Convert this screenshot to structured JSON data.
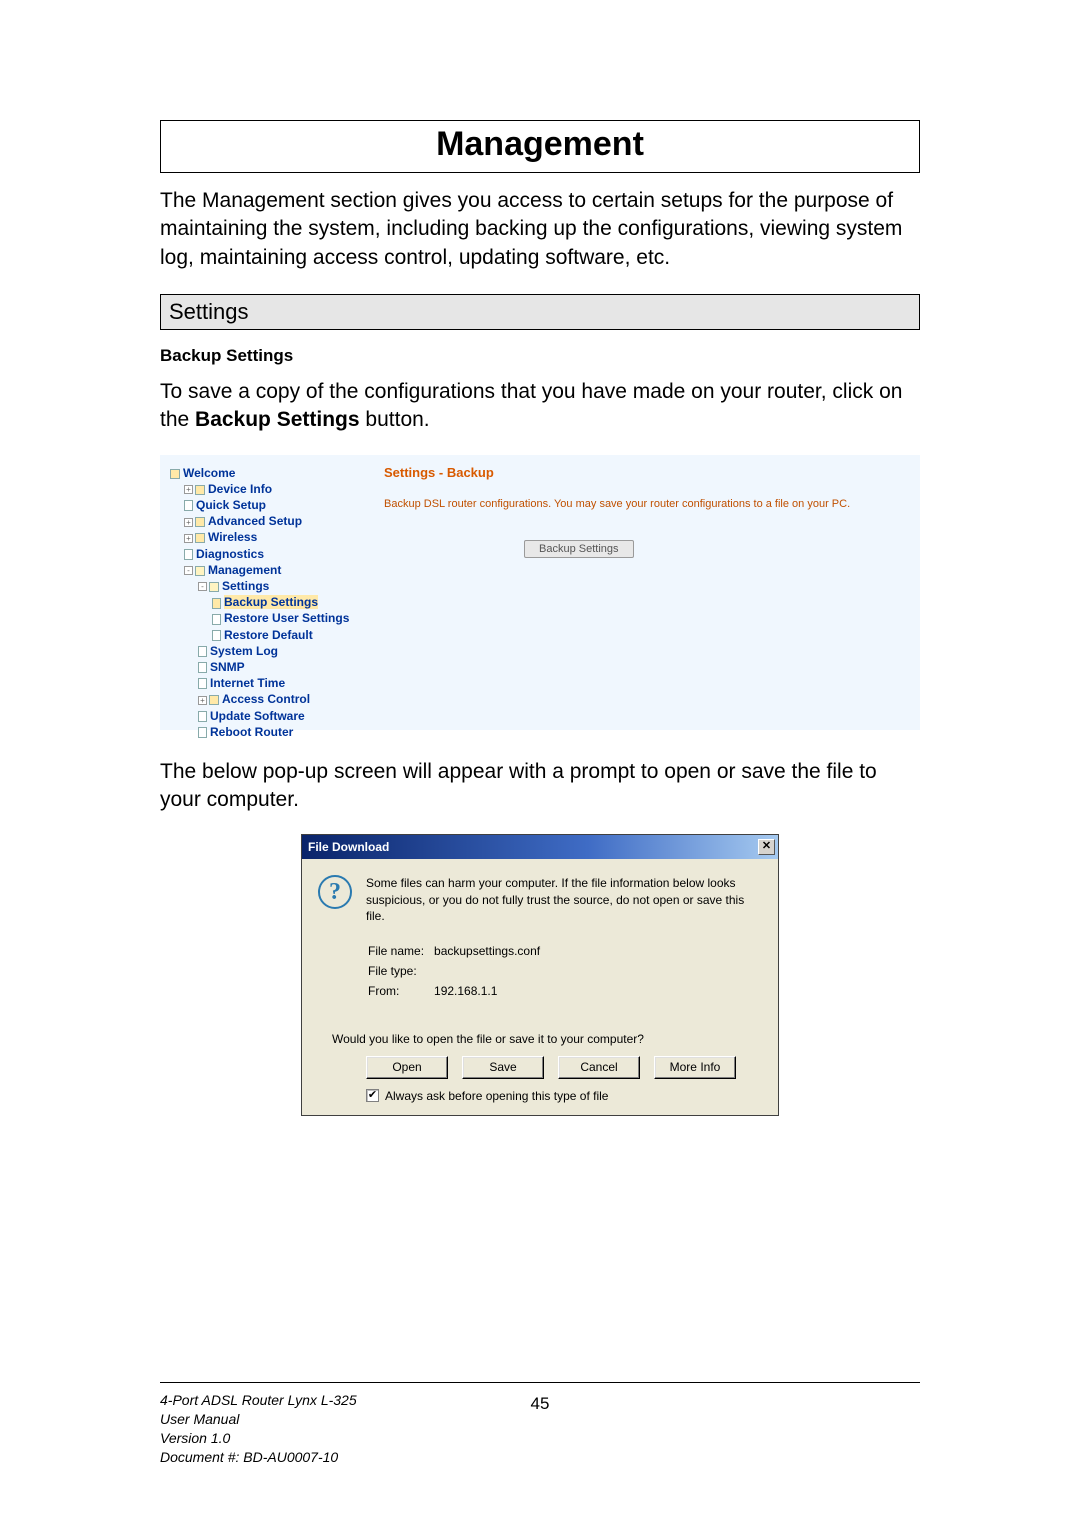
{
  "page_title": "Management",
  "intro": "The Management section gives you access to certain setups for the purpose of maintaining the system, including backing up the configurations, viewing system log, maintaining access control, updating software, etc.",
  "section": "Settings",
  "subsection": "Backup Settings",
  "body_text_prefix": "To save a copy of the configurations that you have made on your router, click on the ",
  "body_text_bold": "Backup Settings",
  "body_text_suffix": " button.",
  "embed1": {
    "title": "Settings - Backup",
    "description": "Backup DSL router configurations. You may save your router configurations to a file on your PC.",
    "button": "Backup Settings",
    "tree": {
      "welcome": "Welcome",
      "device_info": "Device Info",
      "quick_setup": "Quick Setup",
      "advanced_setup": "Advanced Setup",
      "wireless": "Wireless",
      "diagnostics": "Diagnostics",
      "management": "Management",
      "settings": "Settings",
      "backup_settings": "Backup Settings",
      "restore_user": "Restore User Settings",
      "restore_default": "Restore Default",
      "system_log": "System Log",
      "snmp": "SNMP",
      "internet_time": "Internet Time",
      "access_control": "Access Control",
      "update_software": "Update Software",
      "reboot_router": "Reboot Router"
    }
  },
  "body2": "The below pop-up screen will appear with a prompt to open or save the file to your computer.",
  "dialog": {
    "title": "File Download",
    "warning": "Some files can harm your computer. If the file information below looks suspicious, or you do not fully trust the source, do not open or save this file.",
    "filename_label": "File name:",
    "filename_value": "backupsettings.conf",
    "filetype_label": "File type:",
    "filetype_value": "",
    "from_label": "From:",
    "from_value": "192.168.1.1",
    "prompt": "Would you like to open the file or save it to your computer?",
    "buttons": {
      "open": "Open",
      "save": "Save",
      "cancel": "Cancel",
      "more": "More Info"
    },
    "checkbox": "Always ask before opening this type of file"
  },
  "footer": {
    "line1": "4-Port ADSL Router Lynx L-325",
    "line2": "User Manual",
    "line3": "Version 1.0",
    "line4": "Document #:  BD-AU0007-10",
    "page": "45"
  }
}
